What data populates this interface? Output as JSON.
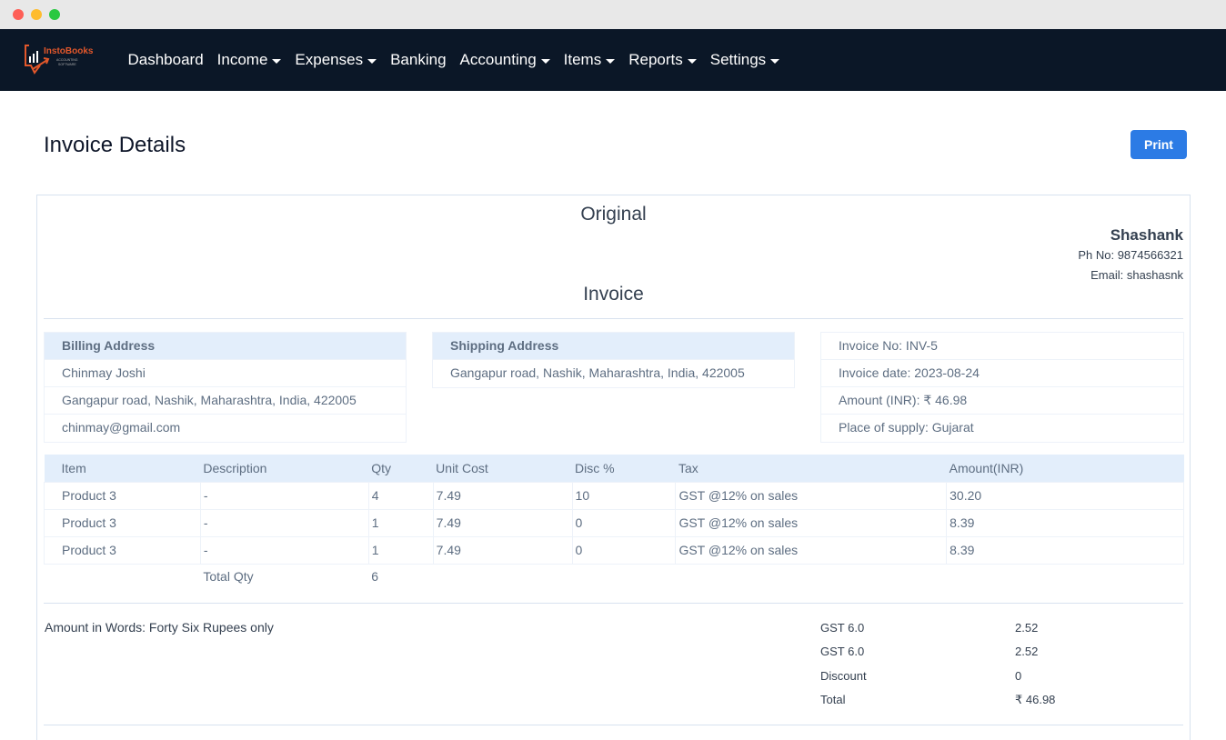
{
  "window": {
    "controls": [
      "close",
      "minimize",
      "maximize"
    ]
  },
  "navbar": {
    "logo": {
      "name": "InstoBooks",
      "tagline": "ACCOUNTING SOFTWARE"
    },
    "items": [
      {
        "label": "Dashboard",
        "dropdown": false
      },
      {
        "label": "Income",
        "dropdown": true
      },
      {
        "label": "Expenses",
        "dropdown": true
      },
      {
        "label": "Banking",
        "dropdown": false
      },
      {
        "label": "Accounting",
        "dropdown": true
      },
      {
        "label": "Items",
        "dropdown": true
      },
      {
        "label": "Reports",
        "dropdown": true
      },
      {
        "label": "Settings",
        "dropdown": true
      }
    ]
  },
  "page": {
    "title": "Invoice Details",
    "print_label": "Print"
  },
  "invoice": {
    "copy_label": "Original",
    "heading": "Invoice",
    "company": {
      "name": "Shashank",
      "phone": "Ph No: 9874566321",
      "email": "Email: shashasnk"
    },
    "billing": {
      "header": "Billing Address",
      "name": "Chinmay Joshi",
      "address": "Gangapur road, Nashik, Maharashtra, India, 422005",
      "email": "chinmay@gmail.com"
    },
    "shipping": {
      "header": "Shipping Address",
      "address": "Gangapur road, Nashik, Maharashtra, India, 422005"
    },
    "meta": {
      "invoice_no": "Invoice No: INV-5",
      "invoice_date": "Invoice date: 2023-08-24",
      "amount": "Amount (INR): ₹ 46.98",
      "place_of_supply": "Place of supply: Gujarat"
    },
    "table": {
      "columns": [
        "Item",
        "Description",
        "Qty",
        "Unit Cost",
        "Disc %",
        "Tax",
        "Amount(INR)"
      ],
      "rows": [
        [
          "Product 3",
          "-",
          "4",
          "7.49",
          "10",
          "GST @12% on sales",
          "30.20"
        ],
        [
          "Product 3",
          "-",
          "1",
          "7.49",
          "0",
          "GST @12% on sales",
          "8.39"
        ],
        [
          "Product 3",
          "-",
          "1",
          "7.49",
          "0",
          "GST @12% on sales",
          "8.39"
        ]
      ],
      "total_qty_label": "Total Qty",
      "total_qty": "6"
    },
    "amount_in_words": "Amount in Words:  Forty Six Rupees only",
    "summary": [
      {
        "label": "GST 6.0",
        "value": "2.52"
      },
      {
        "label": "GST 6.0",
        "value": "2.52"
      },
      {
        "label": "Discount",
        "value": "0"
      },
      {
        "label": "Total",
        "value": "₹ 46.98"
      }
    ]
  }
}
